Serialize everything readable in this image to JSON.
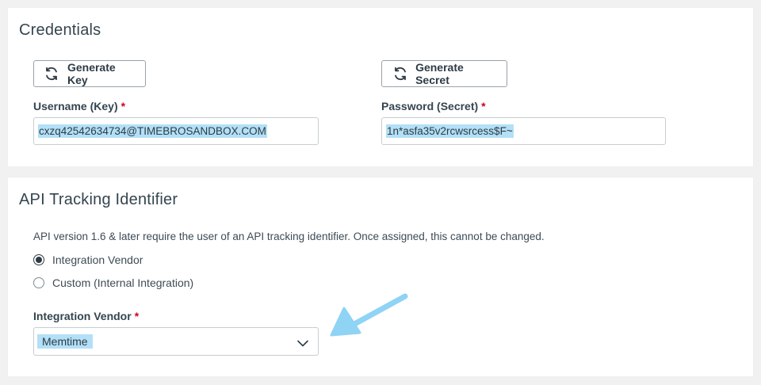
{
  "credentials": {
    "title": "Credentials",
    "generate_key_label": "Generate Key",
    "generate_secret_label": "Generate Secret",
    "username_label": "Username (Key)",
    "username_value": "cxzq42542634734@TIMEBROSANDBOX.COM",
    "password_label": "Password (Secret)",
    "password_value": "1n*asfa35v2rcwsrcess$F~",
    "required_mark": "*"
  },
  "api_tracking": {
    "title": "API Tracking Identifier",
    "description": "API version 1.6 & later require the user of an API tracking identifier. Once assigned, this cannot be changed.",
    "options": [
      {
        "label": "Integration Vendor",
        "selected": true
      },
      {
        "label": "Custom (Internal Integration)",
        "selected": false
      }
    ],
    "vendor_label": "Integration Vendor",
    "vendor_value": "Memtime",
    "required_mark": "*"
  },
  "icons": {
    "refresh": "refresh-icon",
    "chevron": "chevron-down-icon",
    "arrow": "annotation-arrow-icon"
  },
  "colors": {
    "highlight": "#b3e0f7",
    "required": "#d0021b",
    "arrow": "#8fd3f5"
  }
}
